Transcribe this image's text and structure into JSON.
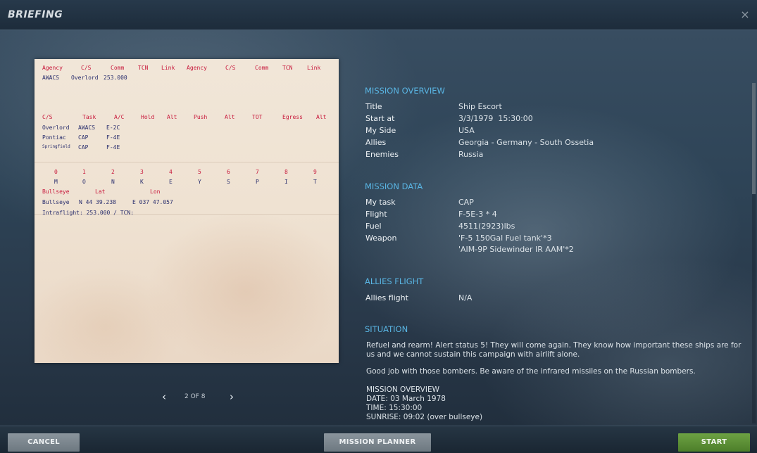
{
  "window": {
    "title": "BRIEFING",
    "close_symbol": "×"
  },
  "kneeboard": {
    "comm_header": [
      "Agency",
      "C/S",
      "Comm",
      "TCN",
      "Link",
      "Agency",
      "C/S",
      "Comm",
      "TCN",
      "Link"
    ],
    "comm_row": {
      "agency": "AWACS",
      "callsign": "Overlord",
      "comm": "253.000"
    },
    "flight_header": [
      "C/S",
      "Task",
      "A/C",
      "Hold",
      "Alt",
      "Push",
      "Alt",
      "TOT",
      "Egress",
      "Alt"
    ],
    "flight_rows": [
      {
        "callsign": "Overlord",
        "task": "AWACS",
        "aircraft": "E-2C"
      },
      {
        "callsign": "Pontiac",
        "task": "CAP",
        "aircraft": "F-4E"
      },
      {
        "callsign": "Springfield",
        "task": "CAP",
        "aircraft": "F-4E"
      }
    ],
    "code_digits": [
      "0",
      "1",
      "2",
      "3",
      "4",
      "5",
      "6",
      "7",
      "8",
      "9"
    ],
    "code_letters": [
      "M",
      "O",
      "N",
      "K",
      "E",
      "Y",
      "S",
      "P",
      "I",
      "T"
    ],
    "bullseye_header": [
      "Bullseye",
      "Lat",
      "Lon"
    ],
    "bullseye_row": {
      "name": "Bullseye",
      "lat": "N 44 39.238",
      "lon": "E 037 47.057"
    },
    "intraflight": "Intraflight: 253.000 / TCN:"
  },
  "pager": {
    "prev_symbol": "‹",
    "page_text": "2 OF 8",
    "next_symbol": "›"
  },
  "mission_overview": {
    "heading": "MISSION OVERVIEW",
    "rows": [
      {
        "label": "Title",
        "value": "Ship Escort"
      },
      {
        "label": "Start at",
        "value": "3/3/1979  15:30:00"
      },
      {
        "label": "My Side",
        "value": "USA"
      },
      {
        "label": "Allies",
        "value": "Georgia - Germany - South Ossetia"
      },
      {
        "label": "Enemies",
        "value": "Russia"
      }
    ]
  },
  "mission_data": {
    "heading": "MISSION DATA",
    "rows": [
      {
        "label": "My task",
        "value": "CAP"
      },
      {
        "label": "Flight",
        "value": "F-5E-3 * 4"
      },
      {
        "label": "Fuel",
        "value": "4511(2923)lbs"
      },
      {
        "label": "Weapon",
        "value": "'F-5 150Gal Fuel tank'*3"
      },
      {
        "label": "",
        "value": "'AIM-9P Sidewinder IR AAM'*2"
      }
    ]
  },
  "allies_flight": {
    "heading": "ALLIES FLIGHT",
    "rows": [
      {
        "label": "Allies flight",
        "value": "N/A"
      }
    ]
  },
  "situation": {
    "heading": "SITUATION",
    "para1": "Refuel and rearm! Alert status 5!  They will come again. They know how important these ships are for us and we cannot sustain this campaign with airlift alone.",
    "para2": "Good job with those bombers. Be aware of the infrared missiles on the Russian bombers.",
    "lines": [
      "MISSION OVERVIEW",
      "DATE: 03 March 1978",
      "TIME: 15:30:00",
      "SUNRISE: 09:02 (over bullseye)"
    ]
  },
  "buttons": {
    "cancel": "CANCEL",
    "mission_planner": "MISSION PLANNER",
    "start": "START"
  }
}
